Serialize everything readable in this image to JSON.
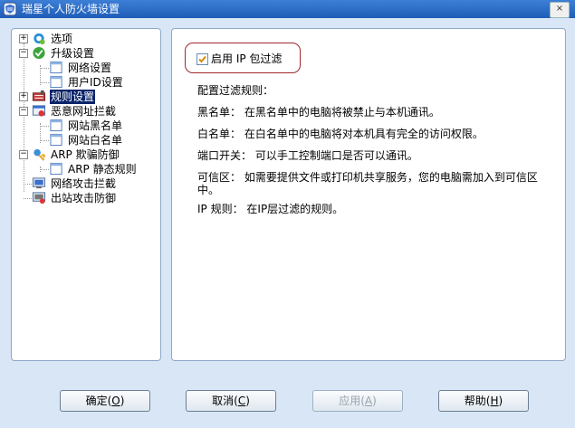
{
  "window": {
    "title": "瑞星个人防火墙设置",
    "close_glyph": "×"
  },
  "tree": {
    "items": [
      {
        "label": "选项",
        "icon": "gear-icon",
        "expander": "+"
      },
      {
        "label": "升级设置",
        "icon": "update-icon",
        "expander": "−"
      },
      {
        "label": "网络设置",
        "icon": "page-icon"
      },
      {
        "label": "用户ID设置",
        "icon": "page-icon"
      },
      {
        "label": "规则设置",
        "icon": "rules-icon",
        "expander": "+"
      },
      {
        "label": "恶意网址拦截",
        "icon": "url-block-icon",
        "expander": "−"
      },
      {
        "label": "网站黑名单",
        "icon": "page-icon"
      },
      {
        "label": "网站白名单",
        "icon": "page-icon"
      },
      {
        "label": "ARP 欺骗防御",
        "icon": "arp-icon",
        "expander": "−"
      },
      {
        "label": "ARP 静态规则",
        "icon": "page-icon"
      },
      {
        "label": "网络攻击拦截",
        "icon": "network-attack-icon"
      },
      {
        "label": "出站攻击防御",
        "icon": "outbound-attack-icon"
      }
    ]
  },
  "content": {
    "enable_filter_label": "启用 IP 包过滤",
    "enable_filter_checked": true,
    "lines": [
      "配置过滤规则：",
      "黑名单： 在黑名单中的电脑将被禁止与本机通讯。",
      "白名单： 在白名单中的电脑将对本机具有完全的访问权限。",
      "端口开关： 可以手工控制端口是否可以通讯。",
      "可信区： 如需要提供文件或打印机共享服务，您的电脑需加入到可信区中。",
      "IP 规则： 在IP层过滤的规则。"
    ]
  },
  "buttons": {
    "ok": {
      "text": "确定",
      "key": "O"
    },
    "cancel": {
      "text": "取消",
      "key": "C"
    },
    "apply": {
      "text": "应用",
      "key": "A"
    },
    "help": {
      "text": "帮助",
      "key": "H"
    }
  },
  "colors": {
    "title_bar": "#1f5db8",
    "selection": "#0a246a",
    "filter_box_border": "#a0282c",
    "window_bg": "#d8e6f6"
  }
}
